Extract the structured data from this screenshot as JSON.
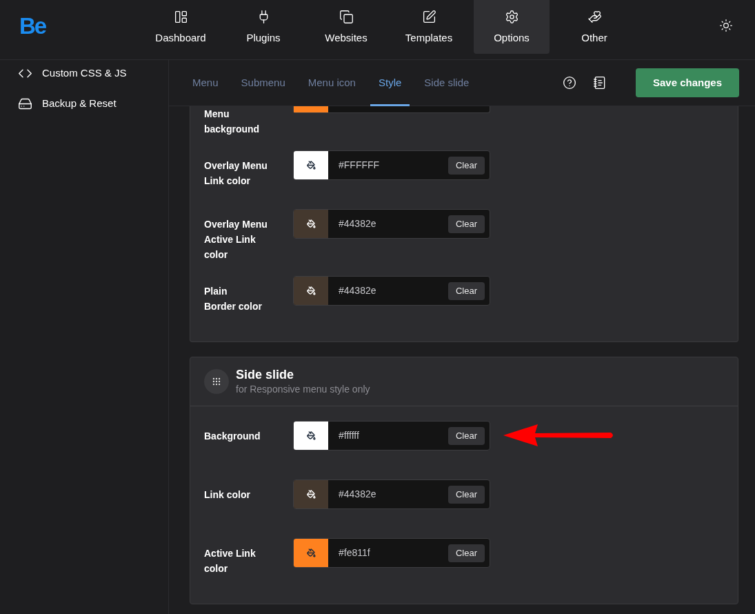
{
  "logo": "Be",
  "nav": [
    {
      "label": "Dashboard",
      "selected": false
    },
    {
      "label": "Plugins",
      "selected": false
    },
    {
      "label": "Websites",
      "selected": false
    },
    {
      "label": "Templates",
      "selected": false
    },
    {
      "label": "Options",
      "selected": true
    },
    {
      "label": "Other",
      "selected": false
    }
  ],
  "sidebar": {
    "items": [
      {
        "label": "Custom CSS & JS"
      },
      {
        "label": "Backup & Reset"
      }
    ]
  },
  "subtabs": [
    {
      "label": "Menu",
      "selected": false
    },
    {
      "label": "Submenu",
      "selected": false
    },
    {
      "label": "Menu icon",
      "selected": false
    },
    {
      "label": "Style",
      "selected": true
    },
    {
      "label": "Side slide",
      "selected": false
    }
  ],
  "save_button": "Save changes",
  "cards": [
    {
      "rows": [
        {
          "label": "Menu\nbackground",
          "color": "#fe811f",
          "clipped": true
        },
        {
          "label": "Overlay Menu\nLink color",
          "color": "#ffffff",
          "value": "#FFFFFF",
          "clear": "Clear"
        },
        {
          "label": "Overlay Menu\nActive Link\ncolor",
          "color": "#44382e",
          "value": "#44382e",
          "clear": "Clear"
        },
        {
          "label": "Plain\nBorder color",
          "color": "#44382e",
          "value": "#44382e",
          "clear": "Clear"
        }
      ]
    },
    {
      "title": "Side slide",
      "subtitle": "for Responsive menu style only",
      "rows": [
        {
          "label": "Background",
          "color": "#ffffff",
          "value": "#ffffff",
          "clear": "Clear",
          "pointed": true
        },
        {
          "label": "Link color",
          "color": "#44382e",
          "value": "#44382e",
          "clear": "Clear"
        },
        {
          "label": "Active Link\ncolor",
          "color": "#fe811f",
          "value": "#fe811f",
          "clear": "Clear"
        }
      ]
    }
  ]
}
